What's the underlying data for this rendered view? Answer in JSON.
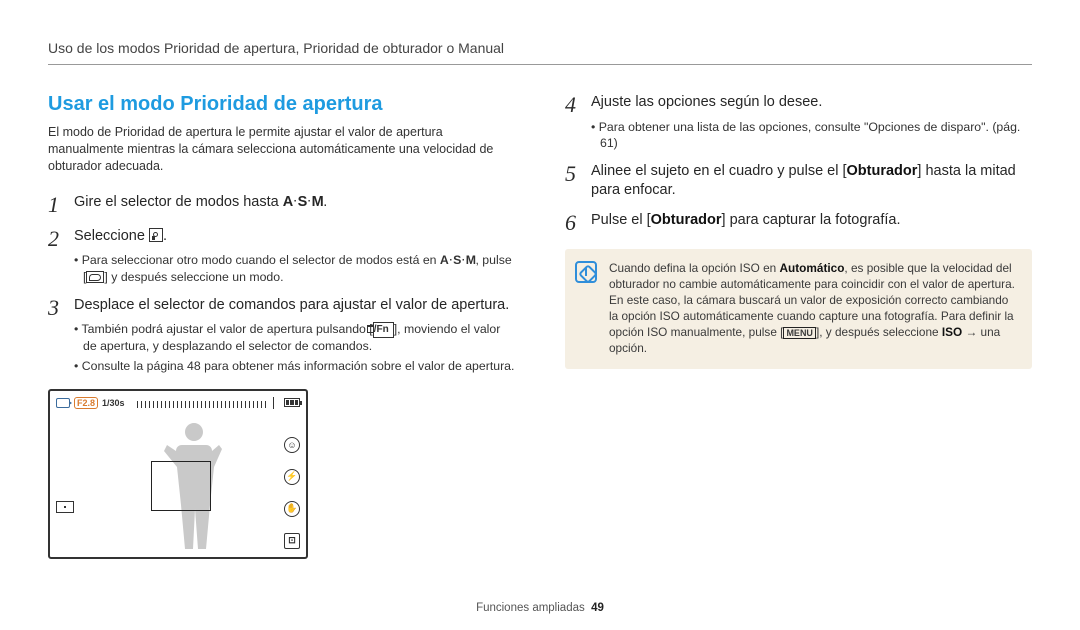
{
  "header": {
    "breadcrumb": "Uso de los modos Prioridad de apertura, Prioridad de obturador o Manual"
  },
  "section": {
    "title": "Usar el modo Prioridad de apertura",
    "intro": "El modo de Prioridad de apertura le permite ajustar el valor de apertura manualmente mientras la cámara selecciona automáticamente una velocidad de obturador adecuada."
  },
  "icons": {
    "asm": "A·S·M",
    "fn_label": "/Fn",
    "menu_key": "MENU",
    "f_badge": "F2.8",
    "shutter": "1/30s"
  },
  "left_steps": [
    {
      "num": "1",
      "text_before": "Gire el selector de modos hasta ",
      "icon": "asm",
      "text_after": ".",
      "bullets": []
    },
    {
      "num": "2",
      "text_before": "Seleccione ",
      "icon": "mode_a",
      "text_after": ".",
      "bullets": [
        "Para seleccionar otro modo cuando el selector de modos está en A·S·M, pulse [↩] y después seleccione un modo."
      ]
    },
    {
      "num": "3",
      "text_before": "Desplace el selector de comandos para ajustar el valor de apertura.",
      "icon": "",
      "text_after": "",
      "bullets": [
        "También podrá ajustar el valor de apertura pulsando [🗑/Fn], moviendo el valor de apertura, y desplazando el selector de comandos.",
        "Consulte la página 48 para obtener más información sobre el valor de apertura."
      ]
    }
  ],
  "right_steps": [
    {
      "num": "4",
      "text": "Ajuste las opciones según lo desee.",
      "bullets": [
        "Para obtener una lista de las opciones, consulte \"Opciones de disparo\". (pág. 61)"
      ]
    },
    {
      "num": "5",
      "text_html": [
        "Alinee el sujeto en el cuadro y pulse el [",
        "Obturador",
        "] hasta la mitad para enfocar."
      ],
      "bullets": []
    },
    {
      "num": "6",
      "text_html": [
        "Pulse el [",
        "Obturador",
        "] para capturar la fotografía."
      ],
      "bullets": []
    }
  ],
  "note": {
    "parts": [
      "Cuando defina la opción ISO en ",
      "Automático",
      ", es posible que la velocidad del obturador no cambie automáticamente para coincidir con el valor de apertura. En este caso, la cámara buscará un valor de exposición correcto cambiando la opción ISO automáticamente cuando capture una fotografía. Para definir la opción ISO manualmente, pulse [",
      "MENU",
      "], y después seleccione ",
      "ISO",
      " → una opción."
    ]
  },
  "footer": {
    "section": "Funciones ampliadas",
    "page": "49"
  }
}
